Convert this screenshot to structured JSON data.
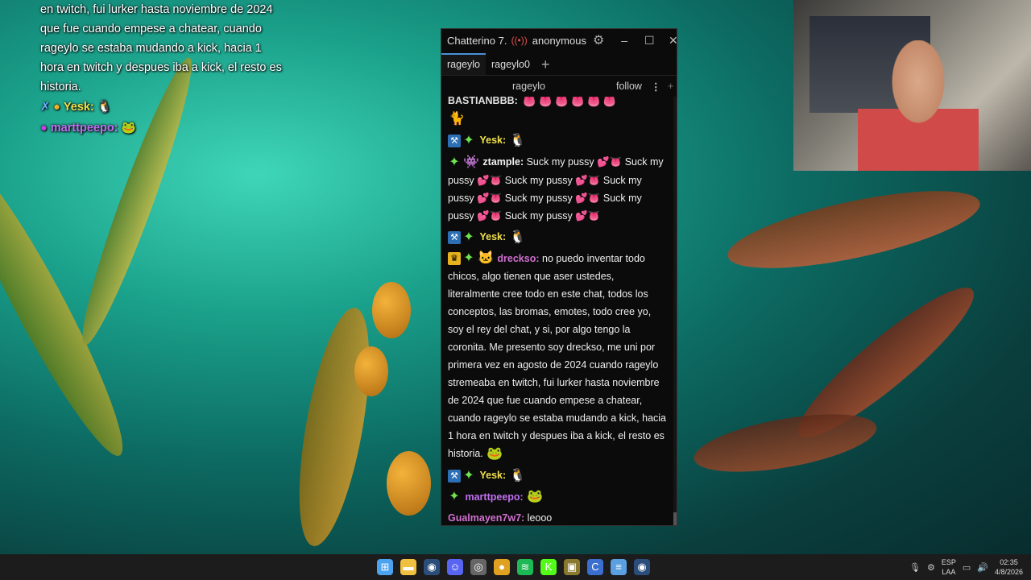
{
  "overlay": {
    "text": "en twitch, fui lurker hasta noviembre de 2024 que fue cuando empese a chatear, cuando rageylo se estaba mudando a kick, hacia 1 hora en twitch y despues iba a kick, el resto es historia.",
    "rows": [
      {
        "user": "Yesk:",
        "color": "#f0e04a"
      },
      {
        "user": "marttpeepo:",
        "color": "#c070f0"
      }
    ]
  },
  "window": {
    "app_title": "Chatterino 7.",
    "account": "anonymous",
    "tabs": [
      "rageylo",
      "rageylo0",
      "+"
    ],
    "channel": "rageylo",
    "follow_label": "follow",
    "menu_glyph": "⋮",
    "add_glyph": "+"
  },
  "messages": [
    {
      "user": "BASTIANBBB:",
      "color": "#e0e0e0",
      "text": ""
    },
    {
      "user": "Yesk:",
      "color": "#f0e04a",
      "text": ""
    },
    {
      "user": "ztample:",
      "color": "#f0f0f0",
      "text": "Suck my pussy 💕👅 Suck my pussy 💕👅 Suck my pussy 💕👅 Suck my pussy 💕👅 Suck my pussy 💕👅 Suck my pussy 💕👅 Suck my pussy 💕👅"
    },
    {
      "user": "Yesk:",
      "color": "#f0e04a",
      "text": ""
    },
    {
      "user": "dreckso:",
      "color": "#d070d0",
      "text": "no puedo inventar todo chicos, algo tienen que aser ustedes, literalmente cree todo en este chat, todos los conceptos, las bromas, emotes, todo cree yo, soy el rey del chat, y si, por algo tengo la coronita. Me presento soy dreckso, me uni por primera vez en agosto de 2024 cuando rageylo stremeaba en twitch, fui lurker hasta noviembre de 2024 que fue cuando empese a chatear, cuando rageylo se estaba mudando a kick, hacia 1 hora en twitch y despues iba a kick, el resto es historia."
    },
    {
      "user": "Yesk:",
      "color": "#f0e04a",
      "text": ""
    },
    {
      "user": "marttpeepo:",
      "color": "#c070f0",
      "text": ""
    },
    {
      "user": "Gualmayen7w7:",
      "color": "#d070d0",
      "text": "leooo"
    }
  ],
  "taskbar": {
    "icons": [
      {
        "name": "windows-start-icon",
        "glyph": "⊞",
        "color": "#4ba3f0"
      },
      {
        "name": "file-explorer-icon",
        "glyph": "▬",
        "color": "#f0c040"
      },
      {
        "name": "steam-icon",
        "glyph": "◉",
        "color": "#2a4d7a"
      },
      {
        "name": "discord-icon",
        "glyph": "☺",
        "color": "#5865f2"
      },
      {
        "name": "app-icon",
        "glyph": "◎",
        "color": "#666"
      },
      {
        "name": "chrome-icon",
        "glyph": "●",
        "color": "#e0a020"
      },
      {
        "name": "spotify-icon",
        "glyph": "≋",
        "color": "#1db954"
      },
      {
        "name": "kick-icon",
        "glyph": "K",
        "color": "#53fc18"
      },
      {
        "name": "app2-icon",
        "glyph": "▣",
        "color": "#8a7a30"
      },
      {
        "name": "ccleaner-icon",
        "glyph": "C",
        "color": "#3a6fd0"
      },
      {
        "name": "notepad-icon",
        "glyph": "≡",
        "color": "#5aa0e0"
      },
      {
        "name": "steam2-icon",
        "glyph": "◉",
        "color": "#2a4d7a"
      }
    ],
    "lang_line1": "ESP",
    "lang_line2": "LAA",
    "time": "02:35",
    "date": "4/8/2026"
  }
}
